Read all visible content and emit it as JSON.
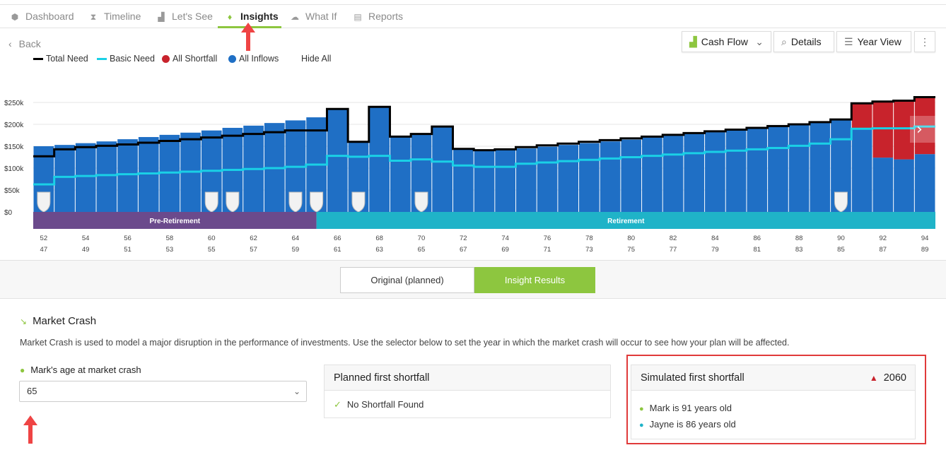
{
  "tabs": [
    {
      "label": "Dashboard",
      "icon": "cube-icon",
      "glyph": "⬢"
    },
    {
      "label": "Timeline",
      "icon": "hourglass-icon",
      "glyph": "⧗"
    },
    {
      "label": "Let's See",
      "icon": "bar-chart-icon",
      "glyph": "▟"
    },
    {
      "label": "Insights",
      "icon": "lightbulb-icon",
      "glyph": "♦"
    },
    {
      "label": "What If",
      "icon": "scenario-icon",
      "glyph": "☁"
    },
    {
      "label": "Reports",
      "icon": "document-icon",
      "glyph": "▤"
    }
  ],
  "active_tab": "Insights",
  "back_label": "Back",
  "toolbar": {
    "cash_flow": "Cash Flow",
    "details": "Details",
    "year_view": "Year View"
  },
  "legend": {
    "total_need": "Total Need",
    "basic_need": "Basic Need",
    "all_shortfall": "All Shortfall",
    "all_inflows": "All Inflows",
    "hide_all": "Hide All"
  },
  "colors": {
    "accent": "#8dc63f",
    "inflows": "#1f6fc5",
    "shortfall": "#c8232c",
    "total_need": "#000000",
    "basic_need": "#1ad0e6",
    "pre_retirement": "#6b4a8c",
    "retirement": "#1fb3c8",
    "highlight": "#e03a3a"
  },
  "chart_data": {
    "type": "bar",
    "ylabel_ticks": [
      "$0",
      "$50k",
      "$100k",
      "$150k",
      "$200k",
      "$250k"
    ],
    "ylim": [
      0,
      280
    ],
    "unit": "$k",
    "x_ages_mark": [
      52,
      53,
      54,
      55,
      56,
      57,
      58,
      59,
      60,
      61,
      62,
      63,
      64,
      65,
      66,
      67,
      68,
      69,
      70,
      71,
      72,
      73,
      74,
      75,
      76,
      77,
      78,
      79,
      80,
      81,
      82,
      83,
      84,
      85,
      86,
      87,
      88,
      89,
      90,
      91,
      92,
      93,
      94
    ],
    "tick_labels_mark": [
      "52",
      "54",
      "56",
      "58",
      "60",
      "62",
      "64",
      "66",
      "68",
      "70",
      "72",
      "74",
      "76",
      "78",
      "80",
      "82",
      "84",
      "86",
      "88",
      "90",
      "92",
      "94"
    ],
    "tick_labels_jayne": [
      "47",
      "49",
      "51",
      "53",
      "55",
      "57",
      "59",
      "61",
      "63",
      "65",
      "67",
      "69",
      "71",
      "73",
      "75",
      "77",
      "79",
      "81",
      "83",
      "85",
      "87",
      "89"
    ],
    "series": [
      {
        "name": "All Inflows",
        "values": [
          150,
          153,
          157,
          161,
          166,
          171,
          176,
          181,
          186,
          192,
          197,
          203,
          209,
          216,
          235,
          160,
          240,
          172,
          178,
          195,
          144,
          141,
          143,
          145,
          149,
          153,
          157,
          161,
          165,
          170,
          174,
          178,
          182,
          186,
          190,
          194,
          199,
          205,
          211,
          190,
          124,
          120,
          132
        ]
      },
      {
        "name": "All Shortfall",
        "values": [
          0,
          0,
          0,
          0,
          0,
          0,
          0,
          0,
          0,
          0,
          0,
          0,
          0,
          0,
          0,
          0,
          0,
          0,
          0,
          0,
          0,
          0,
          0,
          0,
          0,
          0,
          0,
          0,
          0,
          0,
          0,
          0,
          0,
          0,
          0,
          0,
          0,
          0,
          0,
          58,
          126,
          134,
          130
        ]
      },
      {
        "name": "Total Need",
        "values": [
          127,
          143,
          148,
          151,
          154,
          158,
          162,
          166,
          170,
          174,
          178,
          182,
          186,
          186,
          235,
          160,
          240,
          172,
          178,
          195,
          144,
          141,
          143,
          148,
          152,
          156,
          160,
          164,
          168,
          172,
          176,
          180,
          184,
          188,
          192,
          196,
          200,
          205,
          211,
          248,
          252,
          254,
          262
        ]
      },
      {
        "name": "Basic Need",
        "values": [
          63,
          80,
          82,
          84,
          86,
          88,
          90,
          92,
          94,
          96,
          98,
          100,
          103,
          108,
          128,
          126,
          128,
          117,
          120,
          115,
          106,
          103,
          103,
          110,
          113,
          116,
          119,
          122,
          125,
          128,
          131,
          134,
          137,
          140,
          143,
          146,
          151,
          156,
          166,
          190,
          191,
          191,
          195
        ]
      }
    ],
    "phases": [
      "Pre-Retirement",
      "Retirement"
    ]
  },
  "scenario_toggle": {
    "original": "Original (planned)",
    "insight": "Insight Results"
  },
  "market_crash": {
    "title": "Market Crash",
    "description": "Market Crash is used to model a major disruption in the performance of investments. Use the selector below to set the year in which the market crash will occur to see how your plan will be affected.",
    "selector_label": "Mark's age at market crash",
    "selector_value": "65"
  },
  "planned": {
    "title": "Planned first shortfall",
    "result": "No Shortfall Found"
  },
  "simulated": {
    "title": "Simulated first shortfall",
    "year": "2060",
    "mark": "Mark is 91 years old",
    "jayne": "Jayne is 86 years old"
  }
}
